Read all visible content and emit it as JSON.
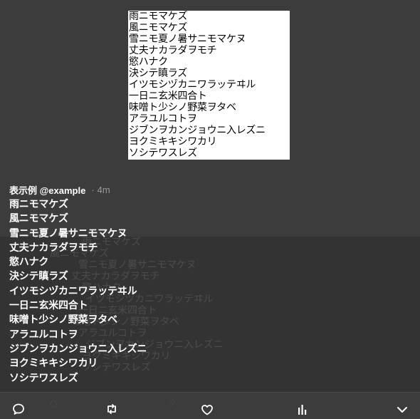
{
  "poem_image": {
    "lines": [
      "雨ニモマケズ",
      "風ニモマケズ",
      "雪ニモ夏ノ暑サニモマケヌ",
      "丈夫ナカラダヲモチ",
      "慾ハナク",
      "決シテ瞋ラズ",
      "イツモシヅカニワラッテヰル",
      "一日ニ玄米四合ト",
      "味噌ト少シノ野菜ヲタベ",
      "アラユルコトヲ",
      "ジブンヲカンジョウニ入レズニ",
      "ヨクミキキシワカリ",
      "ソシテワスレズ"
    ]
  },
  "tweet": {
    "author": "表示例 @example",
    "separator": "·",
    "time": "4m",
    "lines": [
      "雨ニモマケズ",
      "風ニモマケズ",
      "雪ニモ夏ノ暑サニモマケヌ",
      "丈夫ナカラダヲモチ",
      "慾ハナク",
      "決シテ瞋ラズ",
      "イツモシヅカニワラッテヰル",
      "一日ニ玄米四合ト",
      "味噌ト少シノ野菜ヲタベ",
      "アラユルコトヲ",
      "ジブンヲカンジョウニ入レズニ",
      "ヨクミキキシワカリ",
      "ソシテワスレズ"
    ]
  },
  "actions": {
    "icons": [
      "reply-icon",
      "retweet-icon",
      "like-icon",
      "analytics-icon",
      "chevron-down-icon"
    ]
  },
  "colors": {
    "background": "#3c3c3c",
    "lower_panel": "#333333",
    "text": "#ffffff",
    "muted": "#9a9a9a"
  }
}
